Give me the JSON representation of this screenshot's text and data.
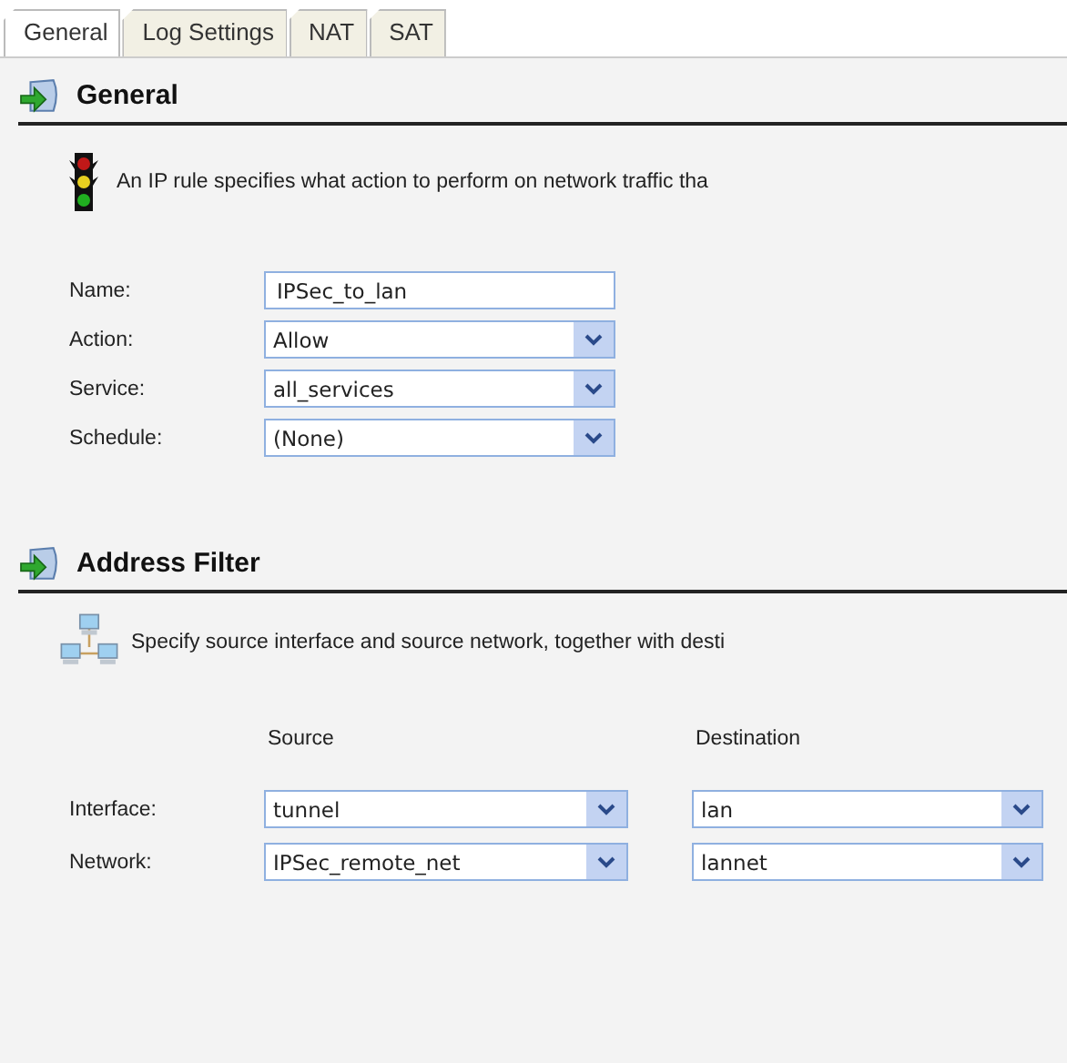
{
  "tabs": [
    {
      "label": "General",
      "selected": true
    },
    {
      "label": "Log Settings",
      "selected": false
    },
    {
      "label": "NAT",
      "selected": false
    },
    {
      "label": "SAT",
      "selected": false
    }
  ],
  "general": {
    "title": "General",
    "description": "An IP rule specifies what action to perform on network traffic tha",
    "fields": [
      {
        "kind": "text",
        "label": "Name:",
        "value": "IPSec_to_lan"
      },
      {
        "kind": "select",
        "label": "Action:",
        "value": "Allow"
      },
      {
        "kind": "select",
        "label": "Service:",
        "value": "all_services"
      },
      {
        "kind": "select",
        "label": "Schedule:",
        "value": "(None)"
      }
    ]
  },
  "address_filter": {
    "title": "Address Filter",
    "description": "Specify source interface and source network, together with desti",
    "columns": [
      "Source",
      "Destination"
    ],
    "rows": [
      {
        "label": "Interface:",
        "values": [
          "tunnel",
          "lan"
        ]
      },
      {
        "label": "Network:",
        "values": [
          "IPSec_remote_net",
          "lannet"
        ]
      }
    ]
  }
}
